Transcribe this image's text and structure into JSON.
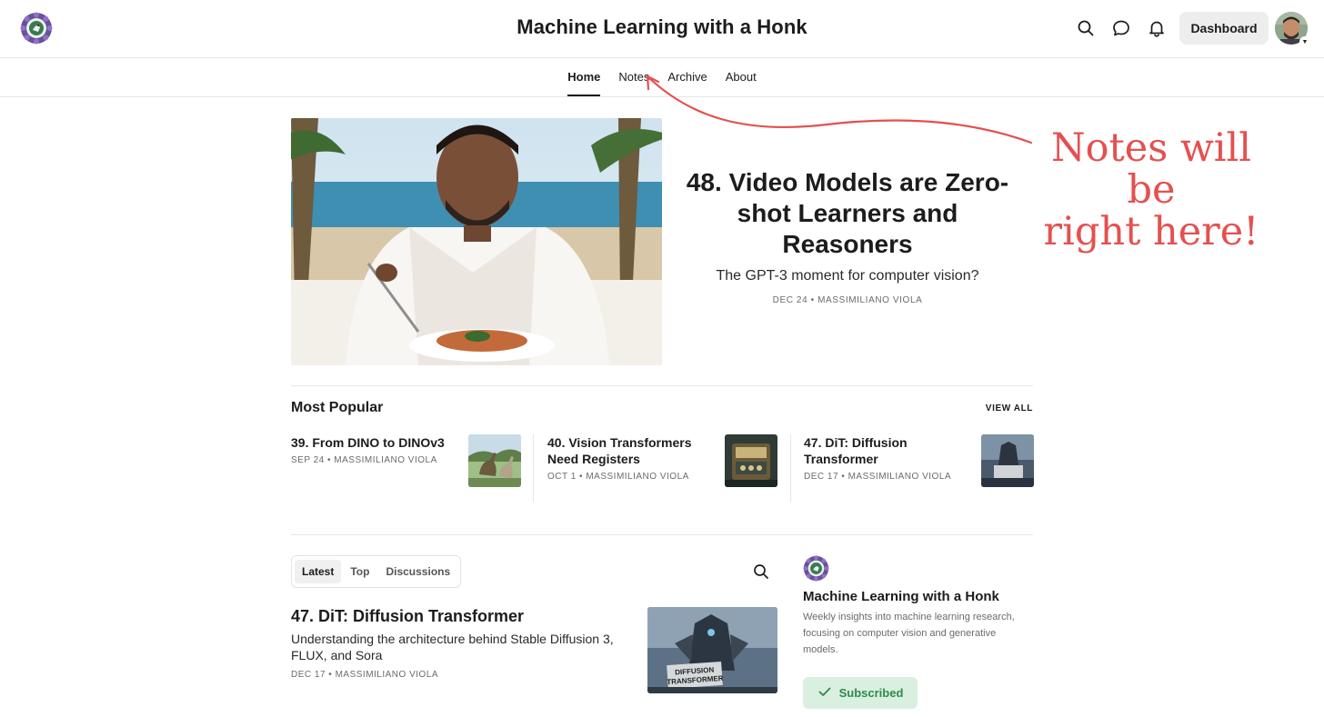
{
  "header": {
    "title": "Machine Learning with a Honk",
    "dashboard_label": "Dashboard",
    "icons": [
      "search-icon",
      "chat-icon",
      "bell-icon"
    ]
  },
  "nav": {
    "items": [
      {
        "label": "Home",
        "active": true
      },
      {
        "label": "Notes",
        "active": false
      },
      {
        "label": "Archive",
        "active": false
      },
      {
        "label": "About",
        "active": false
      }
    ]
  },
  "annotation": {
    "text_line1": "Notes will be",
    "text_line2": "right here!",
    "color": "#e5504f"
  },
  "hero": {
    "title": "48. Video Models are Zero-shot Learners and Reasoners",
    "subtitle": "The GPT-3 moment for computer vision?",
    "meta": "DEC 24 • MASSIMILIANO VIOLA"
  },
  "popular": {
    "title": "Most Popular",
    "view_all": "VIEW ALL",
    "items": [
      {
        "title": "39. From DINO to DINOv3",
        "meta": "SEP 24 • MASSIMILIANO VIOLA"
      },
      {
        "title": "40. Vision Transformers Need Registers",
        "meta": "OCT 1 • MASSIMILIANO VIOLA"
      },
      {
        "title": "47. DiT: Diffusion Transformer",
        "meta": "DEC 17 • MASSIMILIANO VIOLA"
      }
    ]
  },
  "feed": {
    "tabs": [
      {
        "label": "Latest",
        "active": true
      },
      {
        "label": "Top",
        "active": false
      },
      {
        "label": "Discussions",
        "active": false
      }
    ],
    "posts": [
      {
        "title": "47. DiT: Diffusion Transformer",
        "subtitle": "Understanding the architecture behind Stable Diffusion 3, FLUX, and Sora",
        "meta": "DEC 17 • MASSIMILIANO VIOLA",
        "thumb_caption_line1": "DIFFUSION",
        "thumb_caption_line2": "TRANSFORMER"
      }
    ]
  },
  "sidebar": {
    "title": "Machine Learning with a Honk",
    "description": "Weekly insights into machine learning research, focusing on computer vision and generative models.",
    "subscribed_label": "Subscribed"
  },
  "colors": {
    "accent_green": "#2f8a4a",
    "subscribed_bg": "#d9efdf"
  }
}
